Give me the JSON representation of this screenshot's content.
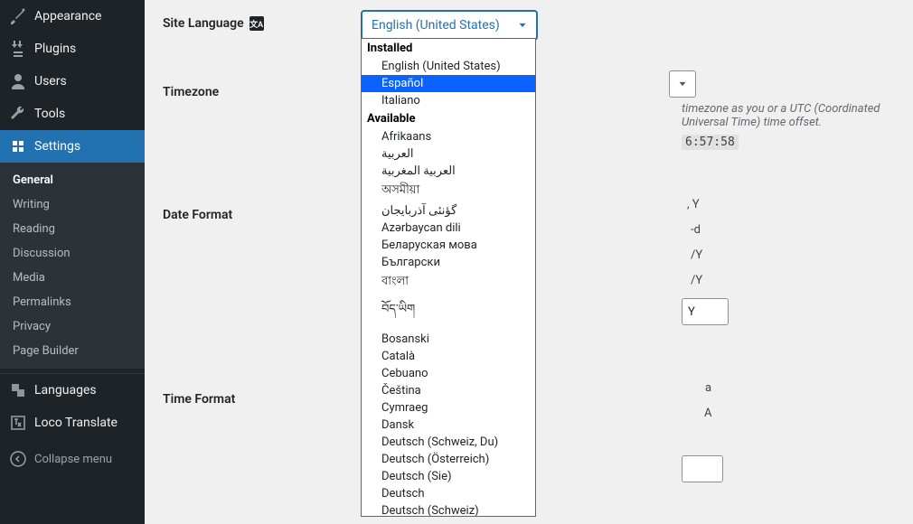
{
  "sidebar": {
    "main": [
      {
        "icon": "appearance",
        "label": "Appearance"
      },
      {
        "icon": "plugins",
        "label": "Plugins"
      },
      {
        "icon": "users",
        "label": "Users"
      },
      {
        "icon": "tools",
        "label": "Tools"
      },
      {
        "icon": "settings",
        "label": "Settings",
        "current": true
      }
    ],
    "sub": [
      {
        "label": "General",
        "current": true
      },
      {
        "label": "Writing"
      },
      {
        "label": "Reading"
      },
      {
        "label": "Discussion"
      },
      {
        "label": "Media"
      },
      {
        "label": "Permalinks"
      },
      {
        "label": "Privacy"
      },
      {
        "label": "Page Builder"
      }
    ],
    "extra": [
      {
        "icon": "languages",
        "label": "Languages"
      },
      {
        "icon": "loco",
        "label": "Loco Translate"
      }
    ],
    "collapse": "Collapse menu"
  },
  "form": {
    "site_language_label": "Site Language",
    "timezone_label": "Timezone",
    "date_format_label": "Date Format",
    "time_format_label": "Time Format",
    "site_language_selected": "English (United States)",
    "timezone_hint": "timezone as you or a UTC (Coordinated Universal Time) time offset.",
    "utc_time_fragment": "6:57:58",
    "date_fragments": [
      ", Y",
      "-d",
      "/Y",
      "/Y",
      "Y"
    ],
    "time_fragments": [
      "a",
      "A"
    ]
  },
  "dropdown": {
    "installed_label": "Installed",
    "available_label": "Available",
    "installed": [
      "English (United States)",
      "Español",
      "Italiano"
    ],
    "highlight_index": 1,
    "available": [
      "Afrikaans",
      "العربية",
      "العربية المغربية",
      "অসমীয়া",
      "گؤنئی آذربایجان",
      "Azərbaycan dili",
      "Беларуская мова",
      "Български",
      "বাংলা",
      "བོད་ཡིག",
      "Bosanski",
      "Català",
      "Cebuano",
      "Čeština",
      "Cymraeg",
      "Dansk",
      "Deutsch (Schweiz, Du)",
      "Deutsch (Österreich)",
      "Deutsch (Sie)",
      "Deutsch",
      "Deutsch (Schweiz)"
    ]
  }
}
